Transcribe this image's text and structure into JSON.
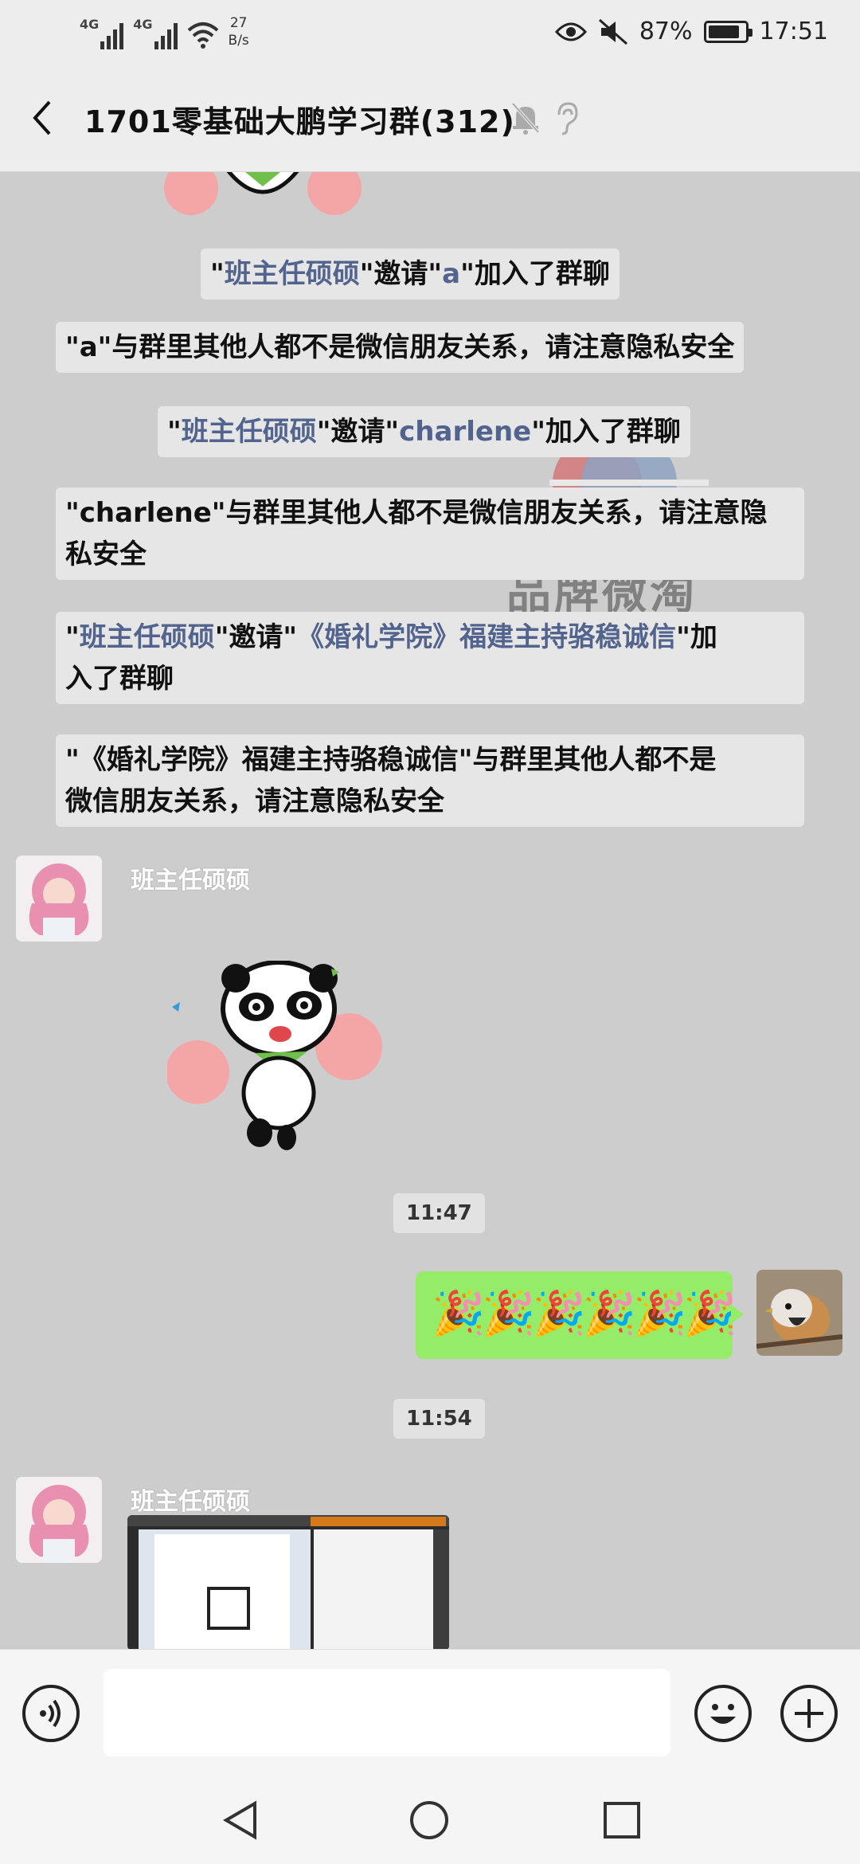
{
  "status": {
    "net1": "4G",
    "net2": "4G",
    "speed_value": "27",
    "speed_unit": "B/s",
    "battery": "87%",
    "battery_level": 0.87,
    "time": "17:51"
  },
  "header": {
    "title": "1701零基础大鹏学习群(312)"
  },
  "messages": {
    "sys1": {
      "q1": "\"",
      "name": "班主任硕硕",
      "q2": "\"邀请\"",
      "name2": "a",
      "tail": "\"加入了群聊"
    },
    "sys2": "\"a\"与群里其他人都不是微信朋友关系，请注意隐私安全",
    "sys3": {
      "q1": "\"",
      "name": "班主任硕硕",
      "q2": "\"邀请\"",
      "name2": "charlene",
      "tail": "\"加入了群聊"
    },
    "sys4": {
      "line1": "\"charlene\"与群里其他人都不是微信朋友关系，请注意隐",
      "line2": "私安全"
    },
    "sys5": {
      "q1": "\"",
      "name": "班主任硕硕",
      "q2": "\"邀请\"",
      "name2": "《婚礼学院》福建主持骆稳诚信",
      "tail": "\"加",
      "line2": "入了群聊"
    },
    "sys6": {
      "line1": "\"《婚礼学院》福建主持骆稳诚信\"与群里其他人都不是",
      "line2": "微信朋友关系，请注意隐私安全"
    },
    "sender1": "班主任硕硕",
    "time1": "11:47",
    "party_emoji": "🎉",
    "time2": "11:54",
    "sender2": "班主任硕硕"
  },
  "watermark": "品牌微淘",
  "colors": {
    "link": "#52648e",
    "bubble_green": "#95ec69",
    "chat_bg": "#cdcdcd"
  }
}
